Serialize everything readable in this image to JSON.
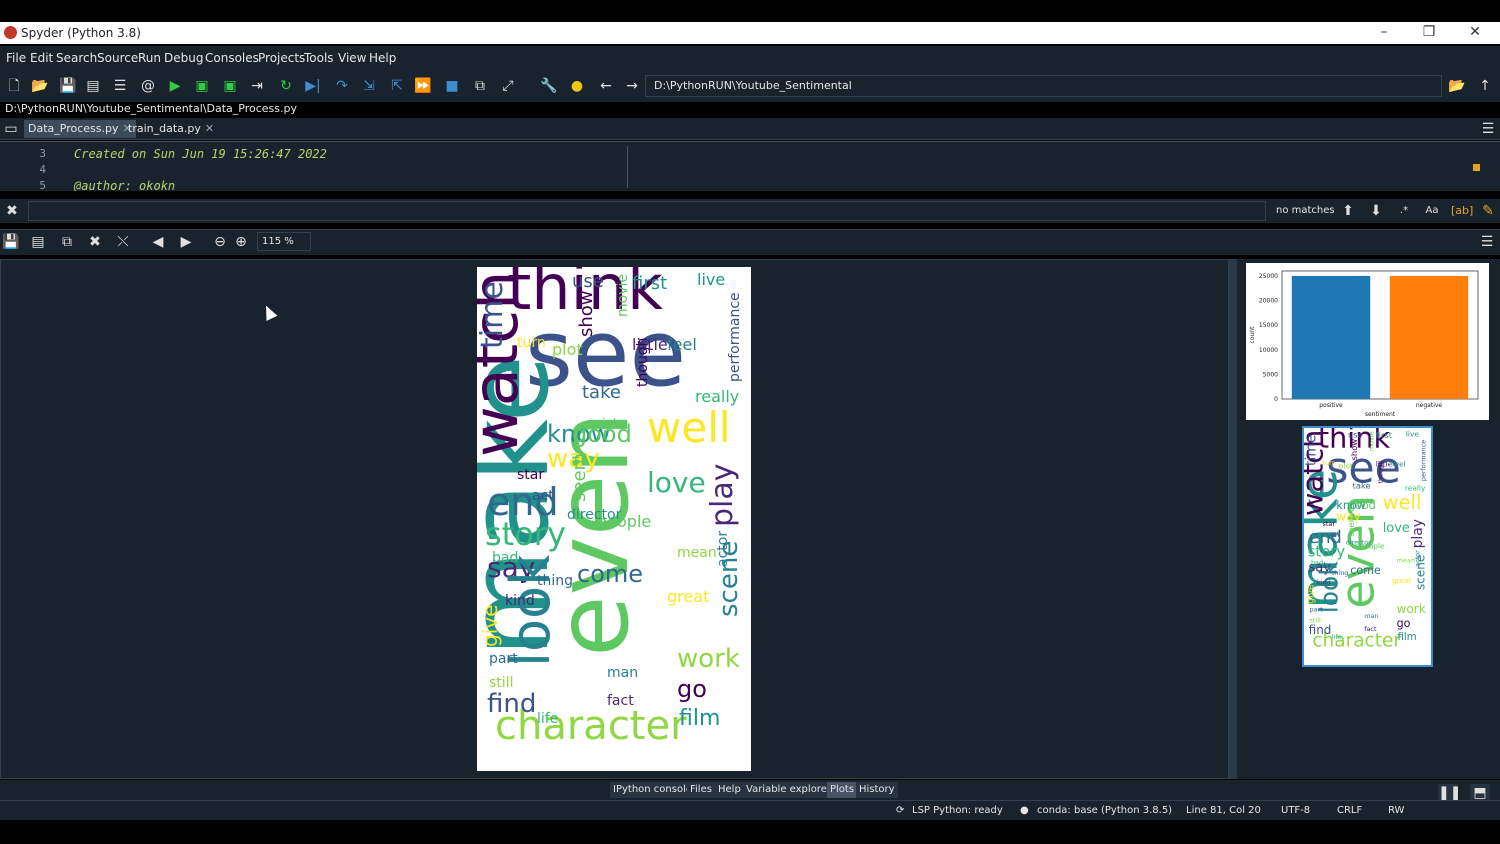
{
  "window": {
    "title": "Spyder (Python 3.8)"
  },
  "menu": [
    "File",
    "Edit",
    "Search",
    "Source",
    "Run",
    "Debug",
    "Consoles",
    "Projects",
    "Tools",
    "View",
    "Help"
  ],
  "toolbar": {
    "working_dir": "D:\\PythonRUN\\Youtube_Sentimental"
  },
  "editor": {
    "file_path": "D:\\PythonRUN\\Youtube_Sentimental\\Data_Process.py",
    "tabs": [
      {
        "label": "Data_Process.py",
        "active": true
      },
      {
        "label": "train_data.py",
        "active": false
      }
    ],
    "lines": [
      {
        "num": "3",
        "text": "Created on Sun Jun 19 15:26:47 2022"
      },
      {
        "num": "4",
        "text": ""
      },
      {
        "num": "5",
        "text": "@author: okokn"
      }
    ]
  },
  "find": {
    "status": "no matches",
    "case_label": "Aa"
  },
  "plots": {
    "zoom": "115 %",
    "wordcloud_words": [
      "think",
      "see",
      "make",
      "even",
      "well",
      "end",
      "story",
      "say",
      "look",
      "character",
      "watch",
      "time",
      "know",
      "good",
      "way",
      "come",
      "love",
      "play",
      "scene",
      "work",
      "go",
      "find",
      "film",
      "people",
      "great",
      "take",
      "really",
      "little",
      "feel",
      "plot",
      "show",
      "use",
      "first",
      "seem",
      "give",
      "part",
      "life",
      "fact",
      "man",
      "still",
      "star",
      "act",
      "live",
      "movie",
      "turn",
      "thing",
      "bad",
      "kind",
      "actor",
      "mean",
      "though",
      "performance",
      "director",
      "point"
    ],
    "bar_chart": {
      "type": "bar",
      "categories": [
        "positive",
        "negative"
      ],
      "values": [
        25000,
        25000
      ],
      "xlabel": "sentiment",
      "ylabel": "count",
      "yticks": [
        "0",
        "5000",
        "10000",
        "15000",
        "20000",
        "25000"
      ],
      "ylim": [
        0,
        26000
      ],
      "colors": [
        "#1f77b4",
        "#ff7f0e"
      ]
    }
  },
  "panes": [
    {
      "label": "IPython console",
      "active": false
    },
    {
      "label": "Files",
      "active": false
    },
    {
      "label": "Help",
      "active": false
    },
    {
      "label": "Variable explorer",
      "active": false
    },
    {
      "label": "Plots",
      "active": true
    },
    {
      "label": "History",
      "active": false
    }
  ],
  "status": {
    "lsp": "LSP Python: ready",
    "conda": "conda: base (Python 3.8.5)",
    "position": "Line 81, Col 20",
    "encoding": "UTF-8",
    "eol": "CRLF",
    "mode": "RW"
  }
}
